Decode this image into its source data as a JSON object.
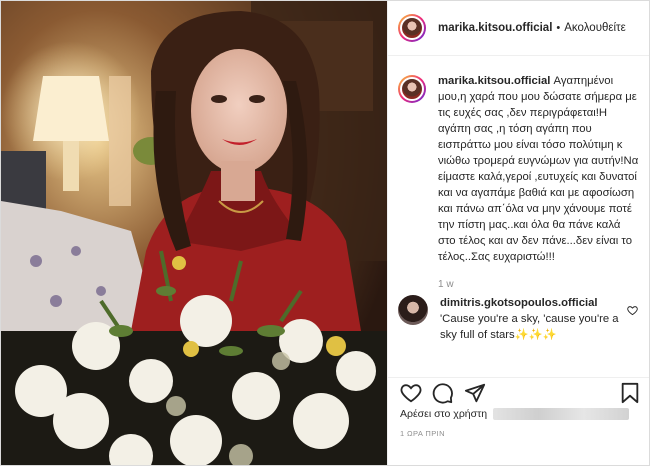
{
  "post": {
    "username": "marika.kitsou.official",
    "follow_status": "Ακολουθείτε",
    "separator": "•",
    "caption": "Αγαπημένοι μου,η χαρά που μου δώσατε σήμερα με τις ευχές σας ,δεν περιγράφεται!Η αγάπη σας ,η τόση αγάπη που εισπράττω μου είναι τόσο πολύτιμη κ νιώθω τρομερά ευγνώμων για αυτήν!Να είμαστε καλά,γεροί ,ευτυχείς και δυνατοί και να αγαπάμε βαθιά και με αφοσίωση και πάνω απ΄όλα να μην χάνουμε ποτέ την πίστη μας..και όλα θα πάνε καλά στο τέλος και αν δεν πάνε...δεν είναι το τέλος..Σας ευχαριστώ!!!",
    "caption_age": "1 w",
    "likes_prefix": "Αρέσει στο χρήστη",
    "post_time": "1 ΩΡΑ ΠΡΙΝ"
  },
  "comment": {
    "username": "dimitris.gkotsopoulos.official",
    "text": "'Cause you're a sky, 'cause you're a sky full of stars✨✨✨"
  },
  "icons": {
    "like": "heart-icon",
    "comment": "comment-icon",
    "share": "paper-plane-icon",
    "save": "bookmark-icon",
    "comment_like": "small-heart-icon"
  },
  "colors": {
    "text": "#262626",
    "muted": "#8e8e8e",
    "border": "#dbdbdb"
  }
}
